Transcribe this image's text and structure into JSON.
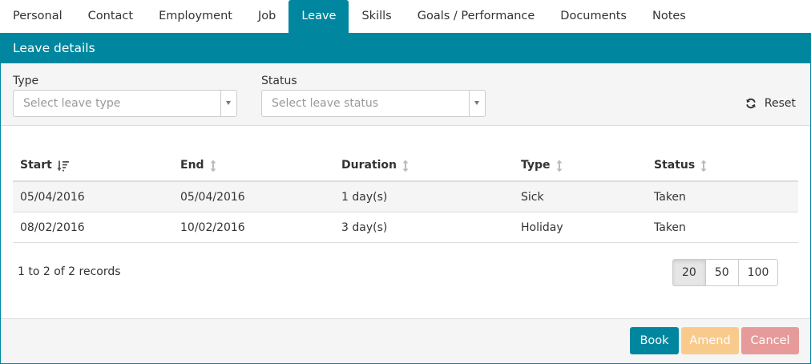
{
  "tabs": [
    {
      "label": "Personal",
      "active": false
    },
    {
      "label": "Contact",
      "active": false
    },
    {
      "label": "Employment",
      "active": false
    },
    {
      "label": "Job",
      "active": false
    },
    {
      "label": "Leave",
      "active": true
    },
    {
      "label": "Skills",
      "active": false
    },
    {
      "label": "Goals / Performance",
      "active": false
    },
    {
      "label": "Documents",
      "active": false
    },
    {
      "label": "Notes",
      "active": false
    }
  ],
  "panel": {
    "title": "Leave details"
  },
  "filters": {
    "type": {
      "label": "Type",
      "placeholder": "Select leave type"
    },
    "status": {
      "label": "Status",
      "placeholder": "Select leave status"
    },
    "reset_label": "Reset"
  },
  "table": {
    "columns": [
      "Start",
      "End",
      "Duration",
      "Type",
      "Status"
    ],
    "rows": [
      [
        "05/04/2016",
        "05/04/2016",
        "1 day(s)",
        "Sick",
        "Taken"
      ],
      [
        "08/02/2016",
        "10/02/2016",
        "3 day(s)",
        "Holiday",
        "Taken"
      ]
    ]
  },
  "pagination": {
    "summary": "1 to 2 of 2 records",
    "sizes": [
      "20",
      "50",
      "100"
    ],
    "active_size": "20"
  },
  "actions": {
    "book": "Book",
    "amend": "Amend",
    "cancel": "Cancel"
  },
  "colors": {
    "accent": "#00879f",
    "amend": "#f8cb8c",
    "cancel": "#e79a9a"
  }
}
